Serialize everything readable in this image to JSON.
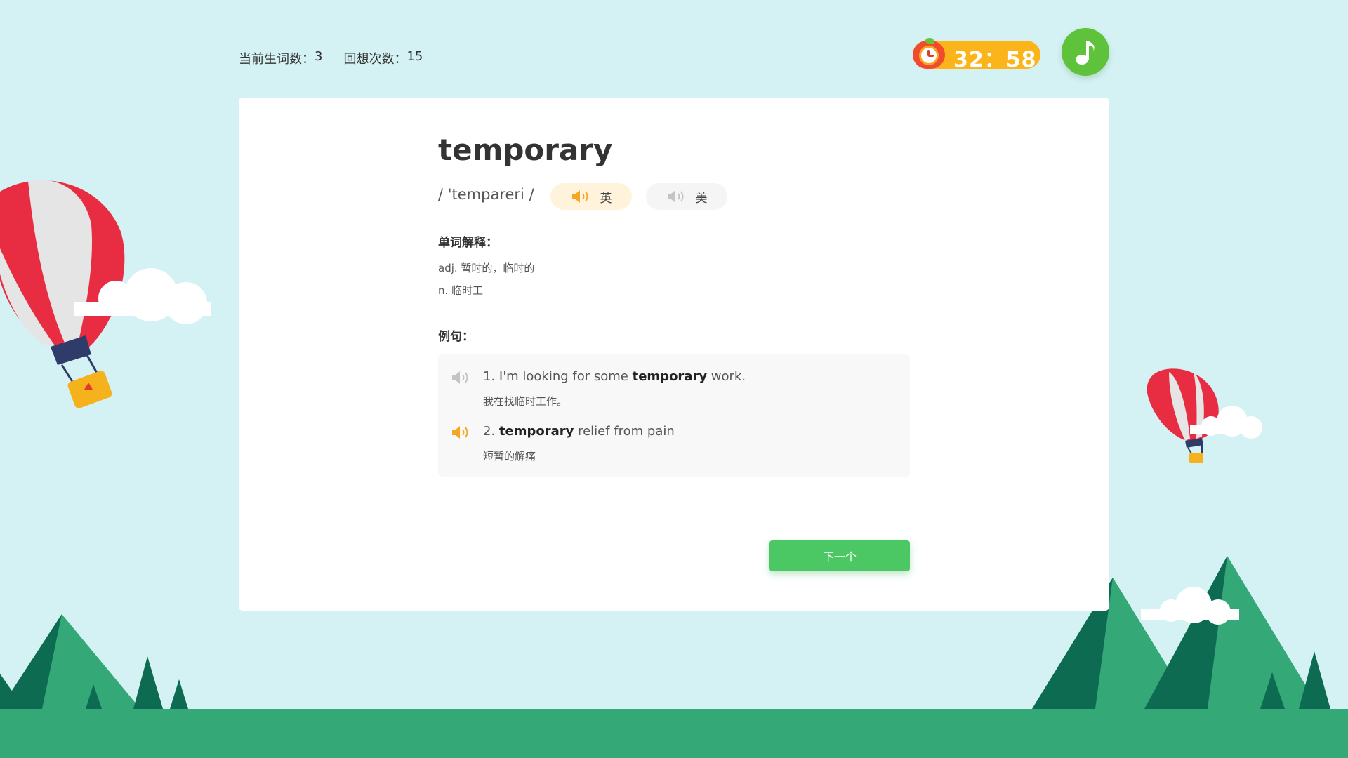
{
  "stats": {
    "new_words_label": "当前生词数：",
    "new_words_value": "3",
    "recall_label": "回想次数：",
    "recall_value": "15"
  },
  "timer": {
    "time": "32：58"
  },
  "word": {
    "text": "temporary",
    "phonetic": "/ 'tempareri /",
    "pron_uk": "英",
    "pron_us": "美"
  },
  "definition": {
    "title": "单词解释：",
    "lines": [
      "adj. 暂时的，临时的",
      "n. 临时工"
    ]
  },
  "examples": {
    "title": "例句：",
    "items": [
      {
        "pre": "1. I'm looking for some ",
        "word": "temporary",
        "post": " work.",
        "zh": "我在找临时工作。"
      },
      {
        "pre": "2. ",
        "word": "temporary",
        "post": " relief from pain",
        "zh": "短暂的解痛"
      }
    ]
  },
  "next_label": "下一个",
  "colors": {
    "background": "#d4f1f3",
    "accent_green": "#4bc764",
    "timer_orange": "#fbb41a",
    "speaker_active": "#f6a623",
    "speaker_inactive": "#c4c4c4"
  }
}
